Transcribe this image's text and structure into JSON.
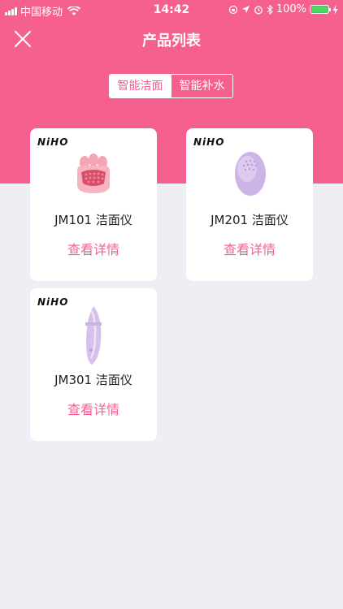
{
  "status_bar": {
    "carrier": "中国移动",
    "time": "14:42",
    "battery": "100%",
    "battery_level": 1.0
  },
  "nav": {
    "title": "产品列表",
    "close_icon": "close-icon"
  },
  "tabs": [
    {
      "label": "智能洁面",
      "active": true
    },
    {
      "label": "智能补水",
      "active": false
    }
  ],
  "products": [
    {
      "brand": "NiHO",
      "name": "JM101 洁面仪",
      "action": "查看详情",
      "icon": "paw-cleanser-icon"
    },
    {
      "brand": "NiHO",
      "name": "JM201 洁面仪",
      "action": "查看详情",
      "icon": "oval-cleanser-icon"
    },
    {
      "brand": "NiHO",
      "name": "JM301 洁面仪",
      "action": "查看详情",
      "icon": "slim-cleanser-icon"
    }
  ],
  "colors": {
    "accent": "#f5608f",
    "background": "#efeef4",
    "card": "#ffffff"
  }
}
